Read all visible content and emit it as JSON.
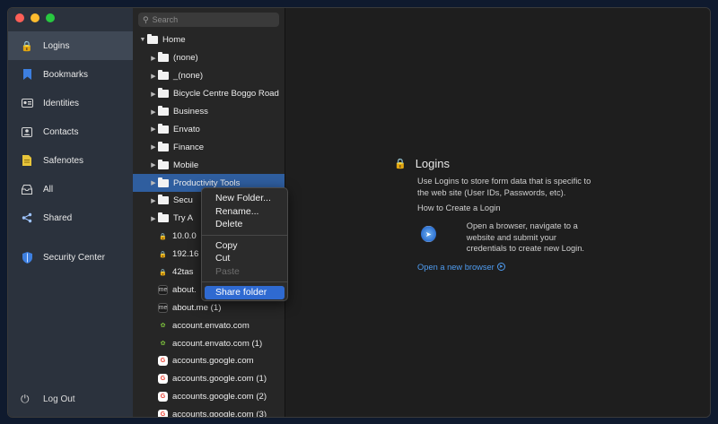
{
  "sidebar": {
    "items": [
      {
        "label": "Logins",
        "icon": "lock-icon",
        "color": "#5bc35b",
        "glyph": "🔒"
      },
      {
        "label": "Bookmarks",
        "icon": "bookmark-icon",
        "color": "#3d7fe0",
        "glyph": "🔖"
      },
      {
        "label": "Identities",
        "icon": "id-card-icon",
        "color": "#d8d8d8",
        "glyph": "🪪"
      },
      {
        "label": "Contacts",
        "icon": "contact-card-icon",
        "color": "#d8d8d8",
        "glyph": "📇"
      },
      {
        "label": "Safenotes",
        "icon": "note-icon",
        "color": "#e8c53a",
        "glyph": "🗒"
      },
      {
        "label": "All",
        "icon": "inbox-icon",
        "color": "#d8d8d8",
        "glyph": "📥"
      },
      {
        "label": "Shared",
        "icon": "share-icon",
        "color": "#9ec4ff",
        "glyph": "⋖"
      }
    ],
    "security_center": "Security Center",
    "logout": "Log Out"
  },
  "search": {
    "placeholder": "Search"
  },
  "tree": {
    "home": "Home",
    "folders": [
      "(none)",
      "_(none)",
      "Bicycle Centre Boggo Road",
      "Business",
      "Envato",
      "Finance",
      "Mobile",
      "Productivity Tools",
      "Secu",
      "Try A"
    ],
    "entries": [
      {
        "label": "10.0.0",
        "icon": "lock"
      },
      {
        "label": "192.16",
        "icon": "lock"
      },
      {
        "label": "42tas",
        "icon": "lock"
      },
      {
        "label": "about.",
        "icon": "about"
      },
      {
        "label": "about.me (1)",
        "icon": "about"
      },
      {
        "label": "account.envato.com",
        "icon": "envato"
      },
      {
        "label": "account.envato.com (1)",
        "icon": "envato"
      },
      {
        "label": "accounts.google.com",
        "icon": "google"
      },
      {
        "label": "accounts.google.com (1)",
        "icon": "google"
      },
      {
        "label": "accounts.google.com (2)",
        "icon": "google"
      },
      {
        "label": "accounts.google.com (3)",
        "icon": "google"
      }
    ]
  },
  "context_menu": {
    "new_folder": "New Folder...",
    "rename": "Rename...",
    "delete": "Delete",
    "copy": "Copy",
    "cut": "Cut",
    "paste": "Paste",
    "share_folder": "Share folder"
  },
  "detail": {
    "title": "Logins",
    "description": "Use Logins to store form data that is specific to the web site (User IDs, Passwords, etc).",
    "howto": "How to Create a Login",
    "step": "Open a browser, navigate to a website and submit your credentials to create new Login.",
    "link": "Open a new browser"
  },
  "colors": {
    "selection": "#2f5e9f",
    "menu_highlight": "#2f6ad1",
    "link": "#4f9cf0"
  }
}
